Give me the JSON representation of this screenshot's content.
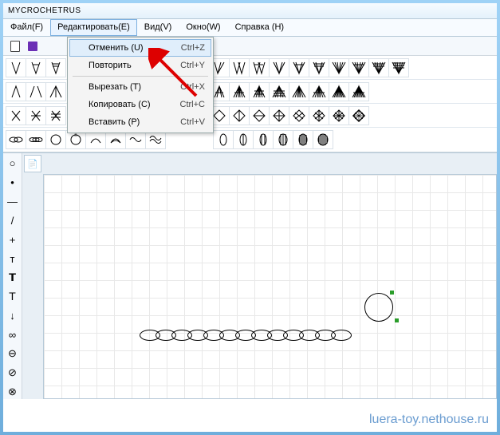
{
  "title": "MYCROCHETRUS",
  "menus": {
    "file": "Файл(F)",
    "edit": "Редактировать(E)",
    "view": "Вид(V)",
    "window": "Окно(W)",
    "help": "Справка (H)"
  },
  "edit_dropdown": {
    "undo": {
      "label": "Отменить (U)",
      "shortcut": "Ctrl+Z"
    },
    "redo": {
      "label": "Повторить",
      "shortcut": "Ctrl+Y"
    },
    "cut": {
      "label": "Вырезать (T)",
      "shortcut": "Ctrl+X"
    },
    "copy": {
      "label": "Копировать (C)",
      "shortcut": "Ctrl+C"
    },
    "paste": {
      "label": "Вставить (P)",
      "shortcut": "Ctrl+V"
    }
  },
  "canvas_corner": "📄",
  "side_tools": [
    "○",
    "•",
    "—",
    "/",
    "+",
    "т",
    "𝗧",
    "𝖳̄",
    "↓",
    "∞",
    "⊖",
    "⊘",
    "⊗"
  ],
  "chain_count": 13,
  "watermark": "luera-toy.nethouse.ru"
}
